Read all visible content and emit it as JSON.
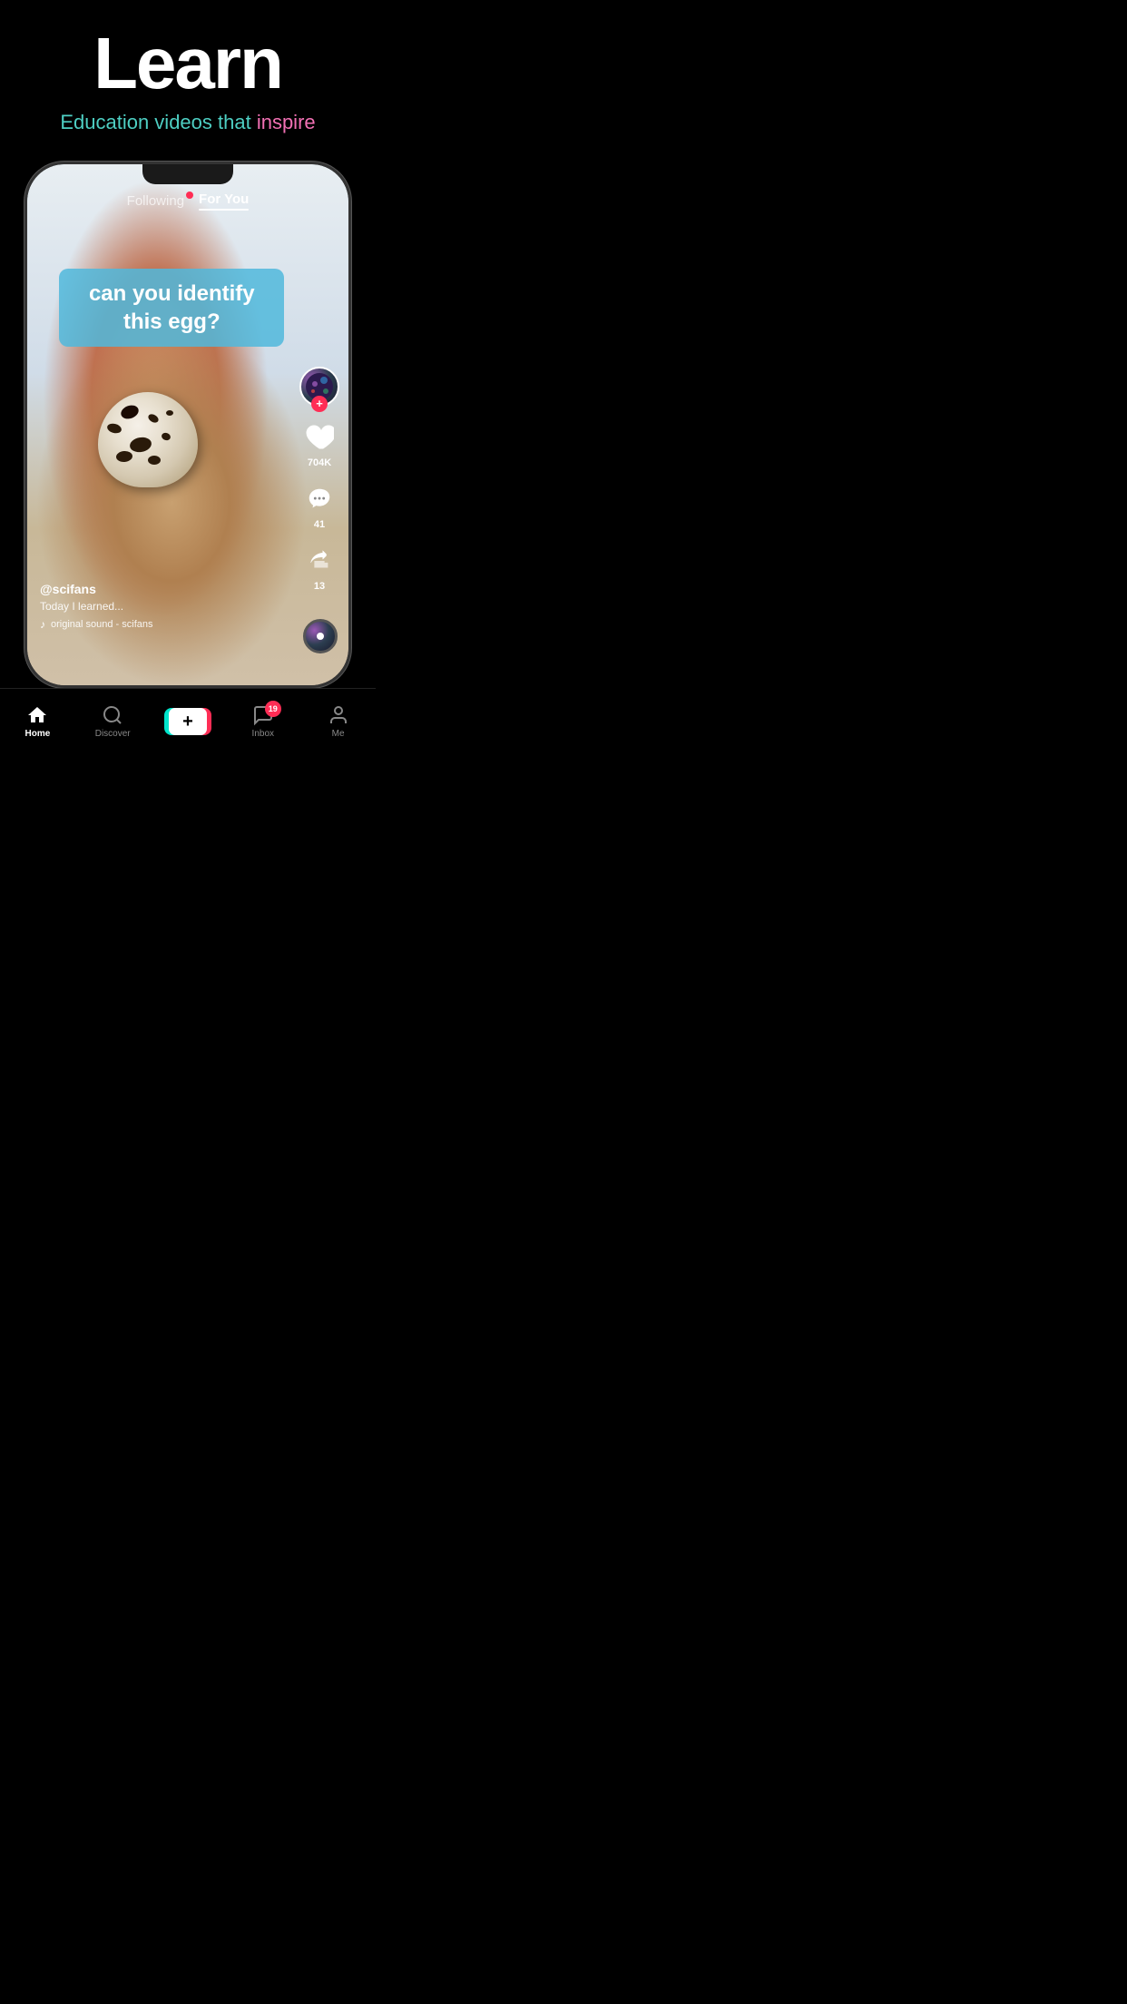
{
  "headline": {
    "title": "Learn",
    "subtitle_plain": "Education videos that ",
    "subtitle_highlight": "inspire"
  },
  "phone": {
    "tabs": {
      "following": "Following",
      "for_you": "For You"
    },
    "video_caption": "can you identify this egg?",
    "user": {
      "handle": "@scifans",
      "description": "Today I learned...",
      "music": "original sound - scifans"
    },
    "actions": {
      "likes": "704K",
      "comments": "41",
      "shares": "13"
    }
  },
  "bottom_nav": {
    "items": [
      {
        "id": "home",
        "label": "Home",
        "active": true
      },
      {
        "id": "discover",
        "label": "Discover",
        "active": false
      },
      {
        "id": "plus",
        "label": "",
        "active": false
      },
      {
        "id": "inbox",
        "label": "Inbox",
        "active": false,
        "badge": "19"
      },
      {
        "id": "me",
        "label": "Me",
        "active": false
      }
    ],
    "plus_label": "+"
  }
}
